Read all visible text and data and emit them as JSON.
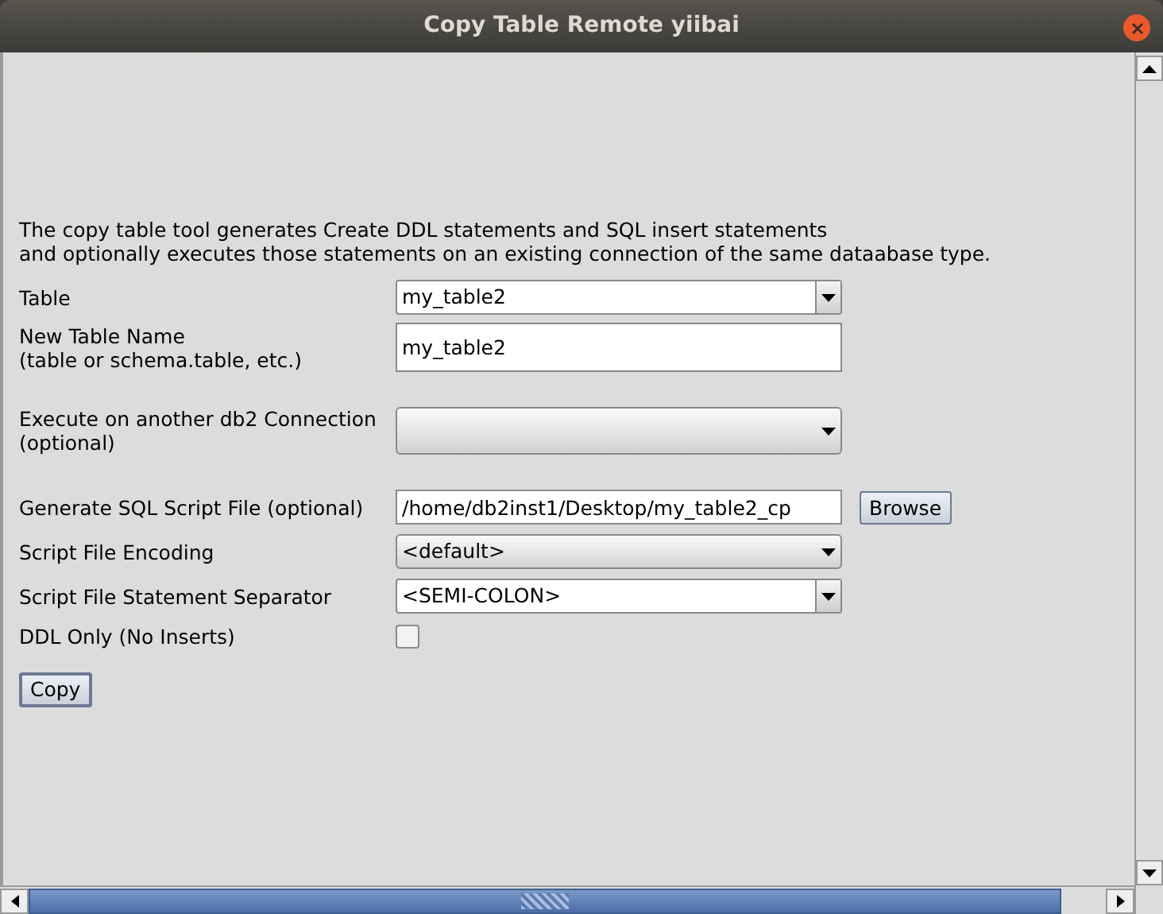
{
  "window": {
    "title": "Copy Table Remote yiibai"
  },
  "description": "The copy table tool generates Create DDL statements and SQL insert statements\nand optionally executes those statements on an existing connection of the same dataabase type.",
  "fields": [
    {
      "kind": "editable-combo",
      "label": "Table",
      "value": "my_table2"
    },
    {
      "kind": "text",
      "label": "New Table Name\n(table or schema.table, etc.)",
      "value": "my_table2"
    },
    {
      "kind": "combo",
      "label": "Execute on another db2 Connection\n(optional)"
    },
    {
      "kind": "text-browse",
      "label": "Generate SQL Script File (optional)",
      "value": "/home/db2inst1/Desktop/my_table2_cp",
      "button": "Browse"
    },
    {
      "kind": "combo",
      "label": "Script File Encoding",
      "value": "<default>"
    },
    {
      "kind": "editable-combo",
      "label": "Script File Statement Separator",
      "value": "<SEMI-COLON>"
    },
    {
      "kind": "checkbox",
      "label": "DDL Only (No Inserts)",
      "checked": false
    }
  ],
  "copy_button": "Copy"
}
